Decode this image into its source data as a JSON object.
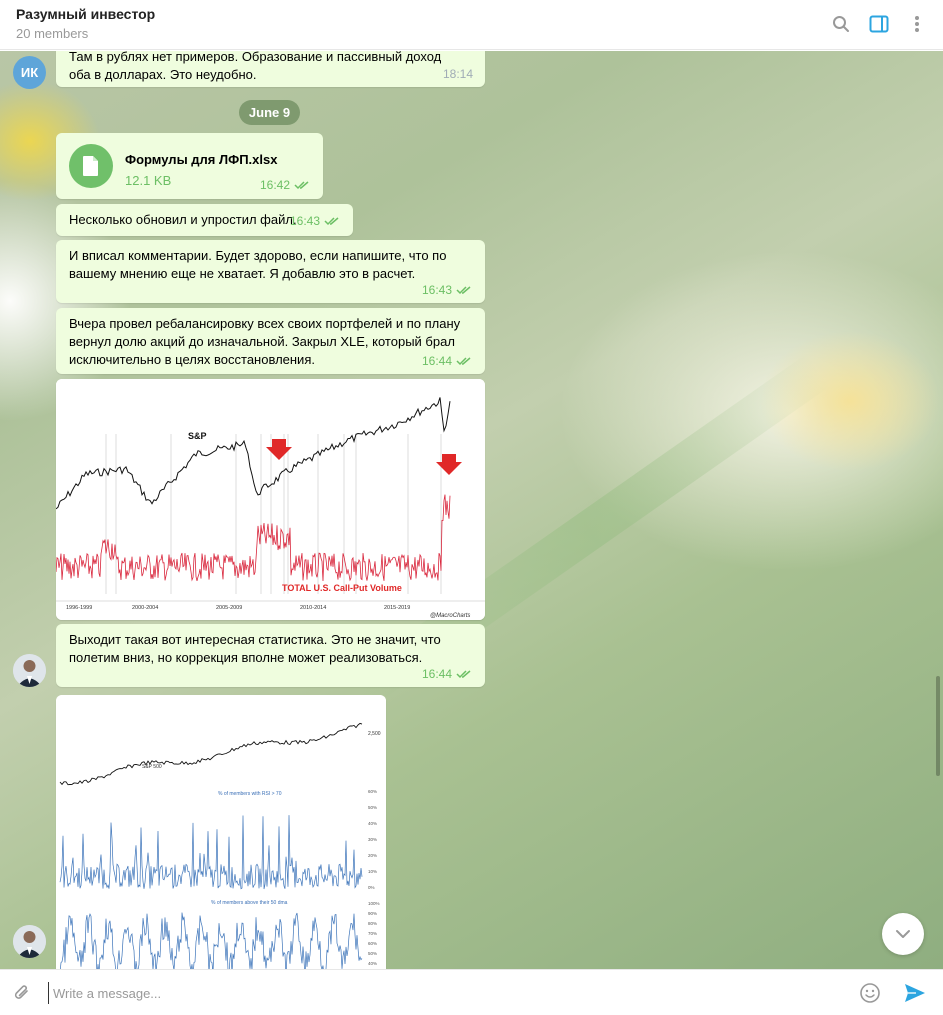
{
  "header": {
    "title": "Разумный инвестор",
    "subtitle": "20 members",
    "icons": [
      "search-icon",
      "sidebar-toggle-icon",
      "more-vertical-icon"
    ]
  },
  "messages": {
    "m0": {
      "avatar_initials": "ИК",
      "text_line1": "Там в рублях нет примеров. Образование и пассивный доход",
      "text_line2": "оба в долларах. Это неудобно.",
      "time": "18:14"
    },
    "date_separator": "June 9",
    "m1": {
      "file_name": "Формулы для ЛФП.xlsx",
      "file_size": "12.1 KB",
      "time": "16:42"
    },
    "m2": {
      "text": "Несколько обновил и упростил файл.",
      "time": "16:43"
    },
    "m3": {
      "text_line1": "И вписал комментарии. Будет здорово, если напишите, что по",
      "text_line2": "вашему мнению еще не хватает. Я добавлю это в расчет.",
      "time": "16:43"
    },
    "m4": {
      "text_line1": "Вчера провел ребалансировку всех своих портфелей и по плану",
      "text_line2": "вернул долю акций до изначальной. Закрыл XLE, который брал",
      "text_line3": "исключительно в целях восстановления.",
      "time": "16:44"
    },
    "m5": {
      "chart_title": "S&P",
      "chart_series_label": "TOTAL U.S. Call-Put Volume",
      "x_labels": [
        "1996-1999",
        "2000-2004",
        "2005-2009",
        "2010-2014",
        "2015-2019"
      ],
      "credit": "@MacroCharts"
    },
    "m6": {
      "text_line1": "Выходит такая вот интересная статистика. Это не значит, что",
      "text_line2": "полетим вниз, но коррекция вполне может реализоваться.",
      "time": "16:44"
    },
    "m7": {
      "top_label": "S&P 500",
      "top_value": "2,500",
      "panel1_title": "% of members with RSI > 70",
      "panel1_ticks": [
        "60%",
        "50%",
        "40%",
        "30%",
        "20%",
        "10%",
        "0%"
      ],
      "panel2_title": "% of members above their 50 dma",
      "panel2_ticks": [
        "100%",
        "90%",
        "80%",
        "70%",
        "60%",
        "50%",
        "40%"
      ]
    }
  },
  "composer": {
    "placeholder": "Write a message..."
  },
  "colors": {
    "bubble_out": "#effdde",
    "accent_blue": "#2ca5e0",
    "check_green": "#6cbf64",
    "avatar_ik": "#5ea5d9"
  },
  "chart_data": [
    {
      "type": "line",
      "title": "S&P",
      "x": [
        "1996-1999",
        "2000-2004",
        "2005-2009",
        "2010-2014",
        "2015-2019"
      ],
      "series": [
        {
          "name": "S&P",
          "values": []
        },
        {
          "name": "TOTAL U.S. Call-Put Volume",
          "values": []
        }
      ]
    },
    {
      "type": "line",
      "series": [
        {
          "name": "S&P 500",
          "values": []
        },
        {
          "name": "% of members with RSI > 70",
          "values": []
        },
        {
          "name": "% of members above their 50 dma",
          "values": []
        }
      ]
    }
  ]
}
